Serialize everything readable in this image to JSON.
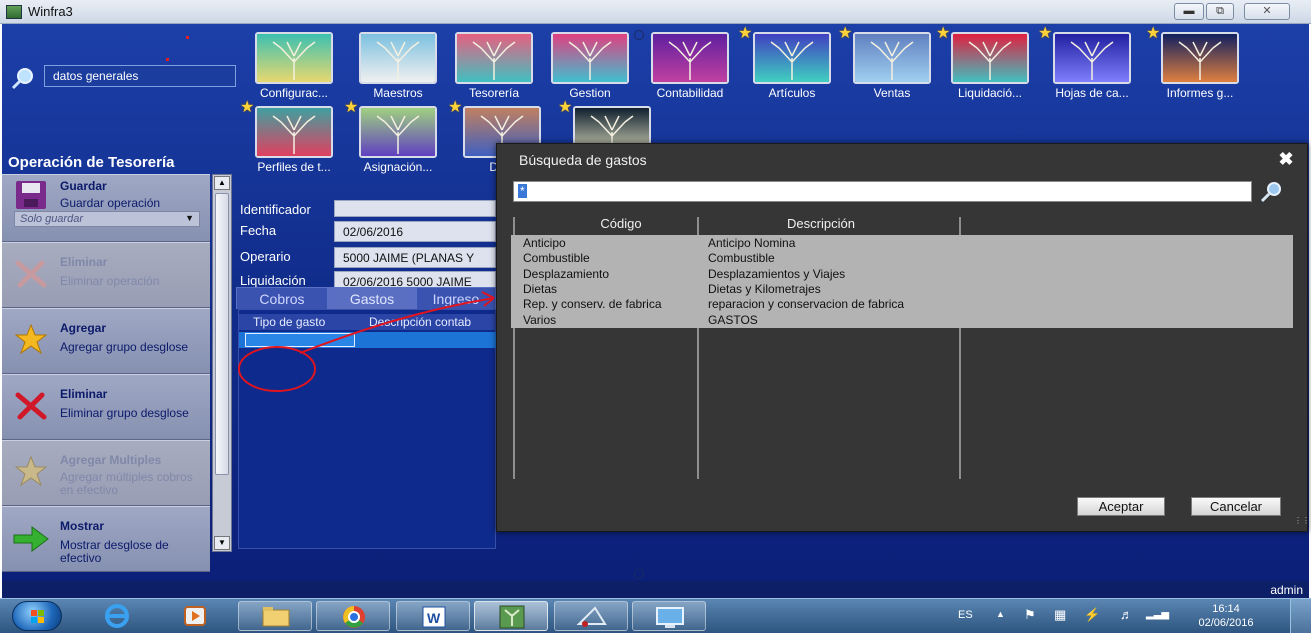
{
  "window": {
    "title": "Winfra3",
    "controls": [
      "minimize",
      "maximize",
      "close"
    ]
  },
  "search": {
    "value": "datos generales"
  },
  "apps": [
    {
      "label": "Configurac...",
      "favorite": false,
      "palette": [
        "#3cc0b0",
        "#e8d870"
      ]
    },
    {
      "label": "Maestros",
      "favorite": false,
      "palette": [
        "#7cc0e0",
        "#f0f0f0"
      ]
    },
    {
      "label": "Tesorería",
      "favorite": false,
      "palette": [
        "#e86080",
        "#40c0c0"
      ]
    },
    {
      "label": "Gestion",
      "favorite": false,
      "palette": [
        "#e04080",
        "#40c0d0"
      ]
    },
    {
      "label": "Contabilidad",
      "favorite": false,
      "palette": [
        "#6020a0",
        "#c040a0"
      ]
    },
    {
      "label": "Artículos",
      "favorite": true,
      "palette": [
        "#4040c0",
        "#40d0c0"
      ]
    },
    {
      "label": "Ventas",
      "favorite": true,
      "palette": [
        "#6080c0",
        "#a0d0f0"
      ]
    },
    {
      "label": "Liquidació...",
      "favorite": true,
      "palette": [
        "#e02040",
        "#40c0c0"
      ]
    },
    {
      "label": "Hojas de ca...",
      "favorite": true,
      "palette": [
        "#2020a0",
        "#8080ff"
      ]
    },
    {
      "label": "Informes g...",
      "favorite": true,
      "palette": [
        "#102060",
        "#e08040"
      ]
    },
    {
      "label": "Perfiles de t...",
      "favorite": true,
      "palette": [
        "#40a0a0",
        "#e04060"
      ]
    },
    {
      "label": "Asignación...",
      "favorite": true,
      "palette": [
        "#a0d080",
        "#6040c0"
      ]
    },
    {
      "label": "Dato",
      "favorite": true,
      "palette": [
        "#c08060",
        "#4060c0"
      ]
    },
    {
      "label": "",
      "favorite": true,
      "palette": [
        "#102030",
        "#e0e0c0"
      ]
    }
  ],
  "section_title": "Operación de Tesorería",
  "operations": [
    {
      "title": "Guardar",
      "desc": "Guardar operación",
      "select": "Solo guardar",
      "icon": "save-icon",
      "enabled": true
    },
    {
      "title": "Eliminar",
      "desc": "Eliminar operación",
      "icon": "delete-icon",
      "enabled": false
    },
    {
      "title": "Agregar",
      "desc": "Agregar grupo desglose",
      "icon": "add-star-icon",
      "enabled": true
    },
    {
      "title": "Eliminar",
      "desc": "Eliminar grupo desglose",
      "icon": "delete-icon",
      "enabled": true
    },
    {
      "title": "Agregar Multiples",
      "desc": "Agregar múltiples cobros en efectivo",
      "icon": "add-star-icon",
      "enabled": false
    },
    {
      "title": "Mostrar",
      "desc": "Mostrar desglose de efectivo",
      "icon": "arrow-right-icon",
      "enabled": true
    }
  ],
  "form": {
    "fields": [
      {
        "label": "Identificador",
        "value": ""
      },
      {
        "label": "Fecha",
        "value": "02/06/2016"
      },
      {
        "label": "Operario",
        "value": "5000 JAIME (PLANAS Y"
      },
      {
        "label": "Liquidación",
        "value": "02/06/2016 5000 JAIME"
      }
    ],
    "tabs": [
      "Cobros",
      "Gastos",
      "Ingreso"
    ],
    "active_tab": "Gastos",
    "grid_headers": [
      "Tipo de gasto",
      "Descripción contab"
    ]
  },
  "modal": {
    "title": "Búsqueda de gastos",
    "search_value": "*",
    "columns": [
      "Código",
      "Descripción"
    ],
    "rows": [
      {
        "codigo": "Anticipo",
        "descripcion": "Anticipo Nomina"
      },
      {
        "codigo": "Combustible",
        "descripcion": "Combustible"
      },
      {
        "codigo": "Desplazamiento",
        "descripcion": "Desplazamientos y Viajes"
      },
      {
        "codigo": "Dietas",
        "descripcion": "Dietas y Kilometrajes"
      },
      {
        "codigo": "Rep. y conserv. de fabrica",
        "descripcion": "reparacion y conservacion de fabrica"
      },
      {
        "codigo": "Varios",
        "descripcion": "GASTOS"
      }
    ],
    "accept_label": "Aceptar",
    "cancel_label": "Cancelar"
  },
  "status": {
    "user": "admin"
  },
  "taskbar": {
    "language": "ES",
    "time": "16:14",
    "date": "02/06/2016",
    "pinned": [
      "internet-explorer-icon",
      "media-player-icon",
      "file-explorer-icon",
      "chrome-icon",
      "word-icon",
      "winfra-icon",
      "snipping-icon",
      "remote-desktop-icon"
    ]
  },
  "colors": {
    "accent_blue": "#112d8c",
    "modal_bg": "#363636",
    "annotation_red": "#e0141e"
  }
}
